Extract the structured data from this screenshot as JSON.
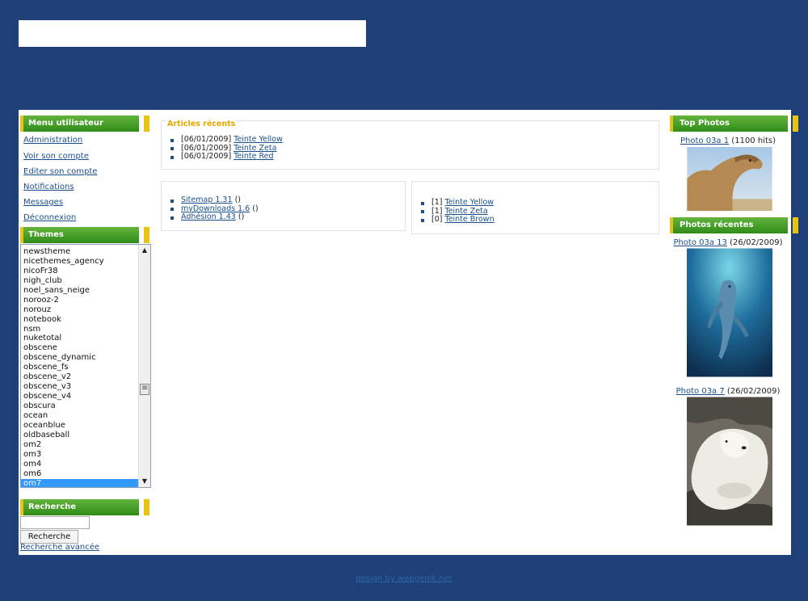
{
  "left_menu": {
    "title": "Menu utilisateur",
    "items": [
      "Administration",
      "Voir son compte",
      "Editer son compte",
      "Notifications",
      "Messages",
      "Déconnexion"
    ]
  },
  "themes": {
    "title": "Themes",
    "items": [
      "newstheme",
      "nicethemes_agency",
      "nicoFr38",
      "nigh_club",
      "noel_sans_neige",
      "norooz-2",
      "norouz",
      "notebook",
      "nsm",
      "nuketotal",
      "obscene",
      "obscene_dynamic",
      "obscene_fs",
      "obscene_v2",
      "obscene_v3",
      "obscene_v4",
      "obscura",
      "ocean",
      "oceanblue",
      "oldbaseball",
      "om2",
      "om3",
      "om4",
      "om6",
      "om7"
    ],
    "selected": "om7"
  },
  "search": {
    "title": "Recherche",
    "button_label": "Recherche",
    "advanced_label": "Recherche avancée",
    "input_value": ""
  },
  "recent_articles": {
    "title": "Articles récents",
    "items": [
      {
        "date": "[06/01/2009]",
        "link": "Teinte Yellow"
      },
      {
        "date": "[06/01/2009]",
        "link": "Teinte Zeta"
      },
      {
        "date": "[06/01/2009]",
        "link": "Teinte Red"
      }
    ]
  },
  "downloads": {
    "items": [
      {
        "link": "Sitemap 1.31",
        "suffix": "()"
      },
      {
        "link": "myDownloads 1.6",
        "suffix": "()"
      },
      {
        "link": "Adhésion 1.43",
        "suffix": "()"
      }
    ]
  },
  "counts": {
    "items": [
      {
        "count": "[1]",
        "link": "Teinte Yellow"
      },
      {
        "count": "[1]",
        "link": "Teinte Zeta"
      },
      {
        "count": "[0]",
        "link": "Teinte Brown"
      }
    ]
  },
  "top_photos": {
    "title": "Top Photos",
    "items": [
      {
        "link": "Photo 03a 1",
        "meta": "(1100 hits)",
        "image": "camel"
      }
    ]
  },
  "recent_photos": {
    "title": "Photos récentes",
    "items": [
      {
        "link": "Photo 03a 13",
        "meta": "(26/02/2009)",
        "image": "dolphin"
      },
      {
        "link": "Photo 03a 7",
        "meta": "(26/02/2009)",
        "image": "polar-bear"
      }
    ]
  },
  "footer": {
    "text": "design by webgenik.net"
  },
  "colors": {
    "page_bg": "#1f3f78",
    "header_green": "#3c9a24",
    "accent_yellow": "#e8c410",
    "title_orange": "#e8a800",
    "link_blue": "#1a4f8a"
  }
}
